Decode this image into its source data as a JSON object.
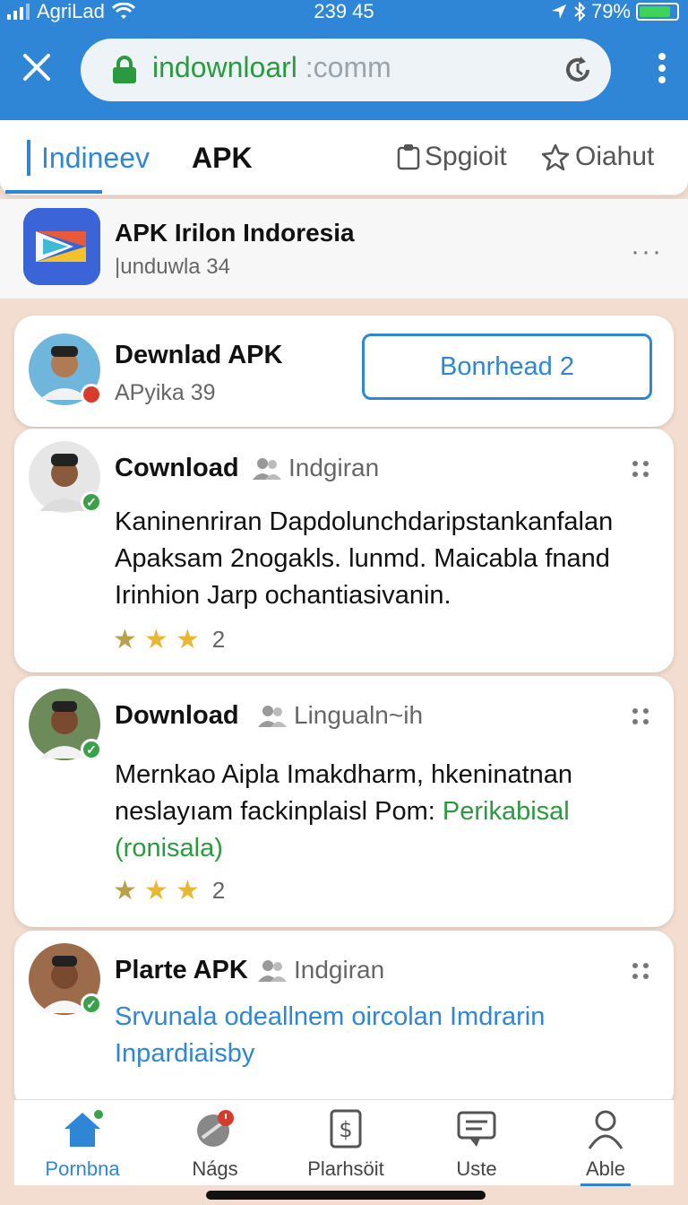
{
  "status": {
    "carrier": "AgriLad",
    "time": "239 45",
    "battery": "79%"
  },
  "browser": {
    "url_main": "indownloarl",
    "url_suffix": ":comm"
  },
  "tabs": {
    "active": "Indineev",
    "apk": "APK",
    "right1": "Spgioit",
    "right2": "Oiahut"
  },
  "app": {
    "title": "APK Irilon Indoresia",
    "subtitle": "|unduwla 34",
    "more": "···"
  },
  "cards": [
    {
      "title": "Dewnlad APK",
      "subtitle": "APyika 39",
      "button": "Bonrhead 2"
    },
    {
      "title": "Cownload",
      "meta": "Indgiran",
      "body": "Kaninenriran Dapdolunchdaripstankanfalan Apaksam 2nogakls. lunmd. Maicabla fnand Irinhion Jarp ochantiasivanin.",
      "rating": "2"
    },
    {
      "title": "Download",
      "meta": "Lingualn~ih",
      "body": "Mernkao Aipla Imakdharm, hkeninatnan neslayıam fackinplaisl Pom:",
      "body_green": "Perikabisal (ronisala)",
      "rating": "2"
    },
    {
      "title": "Plarte APK",
      "meta": "Indgiran",
      "link": "Srvunala odeallnem oircolan Imdrarin Inpardiaisby"
    }
  ],
  "nav": [
    "Pornbna",
    "Nágs",
    "Plarhsöit",
    "Uste",
    "Able"
  ],
  "colors": {
    "primary": "#2f86d6",
    "green": "#2a9a3e",
    "star": "#e8b834"
  }
}
